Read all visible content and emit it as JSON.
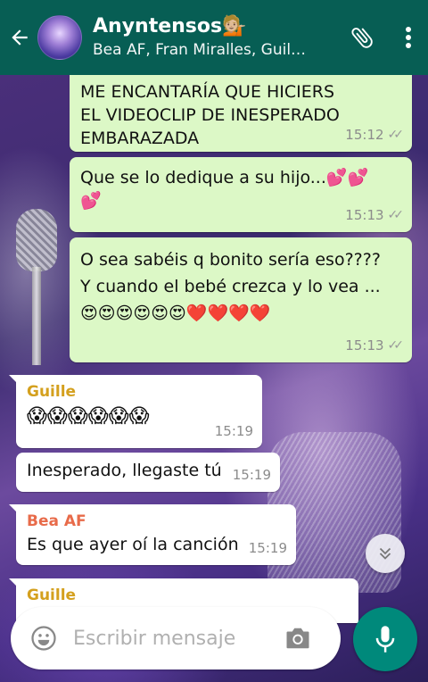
{
  "header": {
    "title": "Anyntensos💁🏼",
    "members": "Bea AF, Fran Miralles, Guil…",
    "icons": {
      "back": "back-arrow-icon",
      "attach": "paperclip-icon",
      "menu": "more-vert-icon"
    }
  },
  "messages": [
    {
      "type": "out",
      "text": "ME ENCANTARÍA QUE HICIERS EL VIDEOCLIP DE INESPERADO EMBARAZADA",
      "time": "15:12"
    },
    {
      "type": "out",
      "text": "Que se lo dedique a su hijo...💕💕💕",
      "time": "15:13"
    },
    {
      "type": "out",
      "text": "O sea sabéis q bonito sería eso???? Y cuando el bebé crezca y lo vea ...😍😍😍😍😍😍❤️❤️❤️❤️",
      "time": "15:13"
    },
    {
      "type": "in",
      "sender": "Guille",
      "sender_color": "#d4a01e",
      "text": "😱😱😱😱😱😱",
      "time": "15:19"
    },
    {
      "type": "in",
      "text": "Inesperado, llegaste tú",
      "time": "15:19"
    },
    {
      "type": "in",
      "sender": "Bea AF",
      "sender_color": "#e86b4a",
      "text": "Es que ayer oí la canción",
      "time": "15:19"
    },
    {
      "type": "in",
      "sender": "Guille",
      "sender_color": "#d4a01e",
      "text": ""
    }
  ],
  "composer": {
    "placeholder": "Escribir mensaje"
  },
  "colors": {
    "header": "#075e54",
    "outgoing": "#dcf8c6",
    "incoming": "#ffffff",
    "fab": "#00897b"
  }
}
